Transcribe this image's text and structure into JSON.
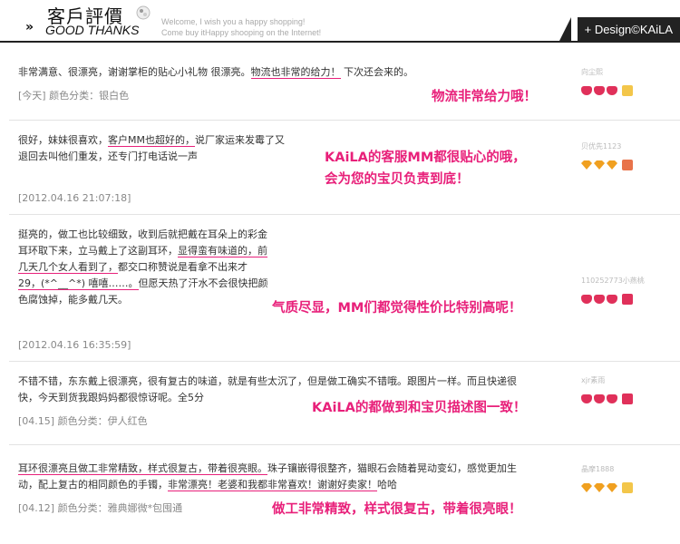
{
  "header": {
    "title_cn": "客戶評價",
    "title_en": "GOOD THANKS",
    "tagline_1": "Welcome, I wish you a happy shopping!",
    "tagline_2": "Come buy itHappy shooping on the Internet!",
    "brand": "+ Design©KAiLA"
  },
  "reviews": [
    {
      "text_lines": [
        "非常满意、很漂亮，谢谢掌柜的贴心小礼物 很漂亮。物流也非常的给力！ 下次还会来的。"
      ],
      "meta": "[今天]   颜色分类：银白色",
      "highlight": "物流非常给力哦！",
      "reviewer": "向尘熙",
      "badge_color": "#f3c64a"
    },
    {
      "text_lines": [
        "很好，妹妹很喜欢，客户MM也超好的，说厂家运来发霉了又",
        "退回去叫他们重发，还专门打电话说一声"
      ],
      "meta": "[2012.04.16 21:07:18]",
      "highlight": "KAiLA的客服MM都很贴心的哦，\n会为您的宝贝负责到底！",
      "reviewer": "贝优先1123",
      "badge_color": "#e8734a"
    },
    {
      "text_lines": [
        "挺亮的，做工也比较细致，收到后就把戴在耳朵上的彩金",
        "耳环取下来，立马戴上了这副耳环，显得蛮有味道的，前",
        "几天几个女人看到了，都交口称赞说是看拿不出来才",
        "29，(*^__^*) 嘻嘻……。但愿天热了汗水不会很快把颜",
        "色腐蚀掉，能多戴几天。"
      ],
      "meta": "[2012.04.16 16:35:59]",
      "highlight": "气质尽显，MM们都觉得性价比特别高呢！",
      "reviewer": "110252773小燕桃",
      "badge_color": "#e0305a"
    },
    {
      "text_lines": [
        "不错不错，东东戴上很漂亮，很有复古的味道，就是有些太沉了，但是做工确实不错哦。跟图片一样。而且快递很",
        "快，今天到货我跟妈妈都很惊讶呢。全5分"
      ],
      "meta": "[04.15]    颜色分类：伊人红色",
      "highlight": "KAiLA的都做到和宝贝描述图一致！",
      "reviewer": "xjr素雨",
      "badge_color": "#e0305a"
    },
    {
      "text_lines": [
        "耳环很漂亮且做工非常精致，样式很复古，带着很亮眼。珠子镶嵌得很整齐，猫眼石会随着晃动变幻，感觉更加生",
        "动，配上复古的相同颜色的手镯，非常漂亮！老婆和我都非常喜欢！谢谢好卖家！哈哈"
      ],
      "meta": "[04.12]    颜色分类：雅典娜微*包囤通",
      "highlight": "做工非常精致，样式很复古，带着很亮眼！",
      "reviewer": "晶摩1888",
      "badge_color": "#f3c64a"
    }
  ]
}
